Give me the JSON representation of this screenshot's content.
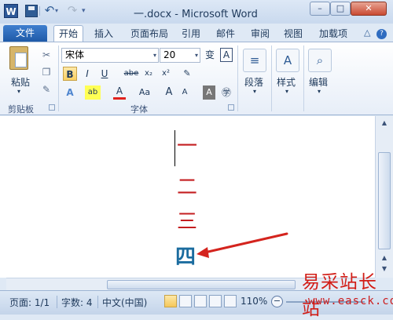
{
  "window": {
    "title": "一.docx - Microsoft Word",
    "app_icon": "W"
  },
  "quick_access": {
    "icons": [
      "save-icon",
      "undo-icon",
      "redo-icon",
      "customize-icon"
    ]
  },
  "window_controls": {
    "minimize": "–",
    "maximize": "□",
    "close": "✕"
  },
  "tabs": {
    "file": "文件",
    "items": [
      "开始",
      "插入",
      "页面布局",
      "引用",
      "邮件",
      "审阅",
      "视图",
      "加载项"
    ],
    "active_index": 0
  },
  "ribbon": {
    "clipboard": {
      "paste_label": "粘贴",
      "group_label": "剪贴板"
    },
    "font": {
      "font_name": "宋体",
      "font_size": "20",
      "group_label": "字体",
      "buttons": [
        "B",
        "I",
        "U",
        "abe",
        "x₂",
        "x²",
        "A",
        "Aa",
        "A",
        "A"
      ]
    },
    "paragraph": {
      "label": "段落"
    },
    "styles": {
      "label": "样式"
    },
    "editing": {
      "label": "编辑"
    }
  },
  "document": {
    "lines": [
      {
        "text": "一",
        "color": "#c41e20"
      },
      {
        "text": "二",
        "color": "#c41e20"
      },
      {
        "text": "三",
        "color": "#c41e20"
      },
      {
        "text": "四",
        "color": "#1b6c9f"
      }
    ]
  },
  "statusbar": {
    "page": "页面: 1/1",
    "words": "字数: 4",
    "language": "中文(中国)",
    "zoom": "110%"
  },
  "watermark": {
    "title": "易采站长站",
    "url": "www.easck.com"
  }
}
